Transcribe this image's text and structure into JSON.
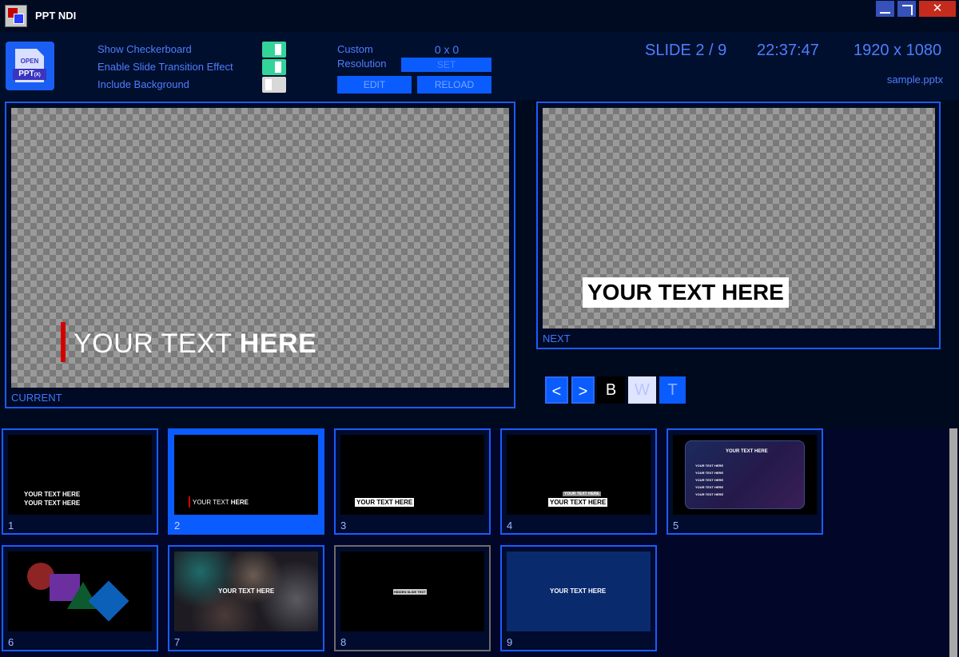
{
  "window": {
    "title": "PPT NDI",
    "close_glyph": "✕"
  },
  "toolbar": {
    "open_button": {
      "top_label": "OPEN",
      "bottom_label": "PPT",
      "bottom_suffix": "(X)"
    },
    "options": [
      {
        "label": "Show Checkerboard",
        "enabled": true
      },
      {
        "label": "Enable Slide Transition Effect",
        "enabled": true
      },
      {
        "label": "Include Background",
        "enabled": false
      }
    ],
    "custom_resolution": {
      "label_line1": "Custom",
      "label_line2": "Resolution",
      "value": "0 x 0",
      "set_label": "SET"
    },
    "edit_label": "EDIT",
    "reload_label": "RELOAD"
  },
  "status": {
    "slide": "SLIDE 2 / 9",
    "time": "22:37:47",
    "resolution": "1920 x 1080",
    "filename": "sample.pptx"
  },
  "current_preview": {
    "label": "CURRENT",
    "text_normal": "YOUR TEXT ",
    "text_bold": "HERE"
  },
  "next_preview": {
    "label": "NEXT",
    "text": "YOUR TEXT HERE"
  },
  "navigation": {
    "prev": "<",
    "next": ">",
    "black": "B",
    "white": "W",
    "transparent": "T"
  },
  "thumbnails": [
    {
      "number": "1",
      "line1": "YOUR TEXT HERE",
      "line2": "YOUR TEXT HERE"
    },
    {
      "number": "2",
      "text_normal": "YOUR TEXT ",
      "text_bold": "HERE",
      "selected": true
    },
    {
      "number": "3",
      "text": "YOUR TEXT HERE"
    },
    {
      "number": "4",
      "small": "YOUR TEXT HERE",
      "text": "YOUR TEXT HERE"
    },
    {
      "number": "5",
      "title": "YOUR TEXT HERE",
      "items": [
        "YOUR TEXT HERE",
        "YOUR TEXT HERE",
        "YOUR TEXT HERE",
        "YOUR TEXT HERE",
        "YOUR TEXT HERE"
      ]
    },
    {
      "number": "6"
    },
    {
      "number": "7",
      "text": "YOUR TEXT HERE"
    },
    {
      "number": "8",
      "text": "HIDDEN SLIDE TEST",
      "hidden": true
    },
    {
      "number": "9",
      "text": "YOUR TEXT HERE"
    }
  ],
  "colors": {
    "accent_blue": "#0a5cff",
    "toggle_on": "#34d399",
    "lower_third_red": "#d40000",
    "slide9_background": "#0a2a6e"
  }
}
